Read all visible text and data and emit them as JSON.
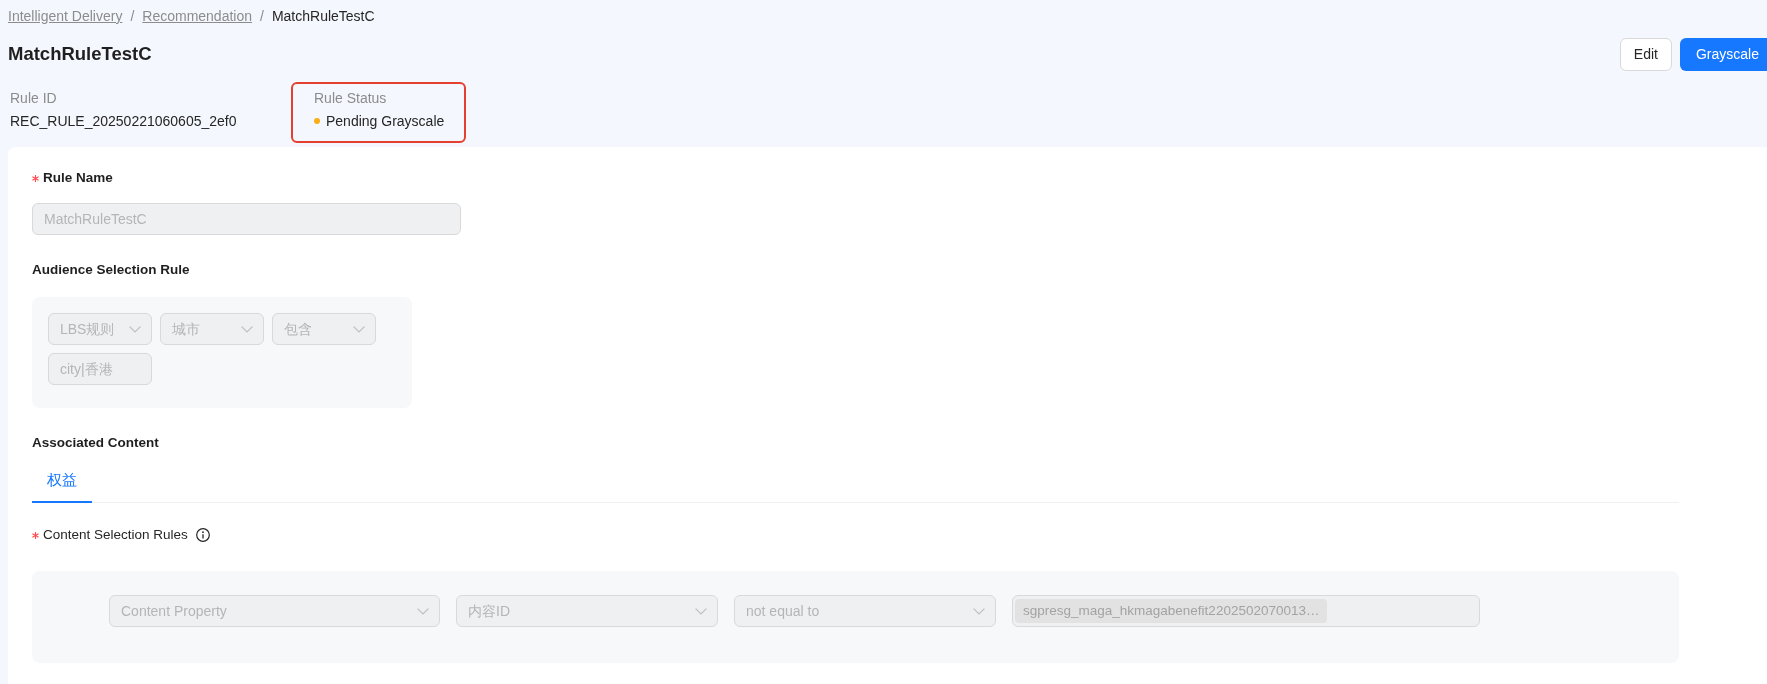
{
  "breadcrumb": [
    {
      "kind": "link",
      "label": "Intelligent Delivery"
    },
    {
      "kind": "separator",
      "label": "/"
    },
    {
      "kind": "link",
      "label": "Recommendation"
    },
    {
      "kind": "separator",
      "label": "/"
    },
    {
      "kind": "current",
      "label": "MatchRuleTestC"
    }
  ],
  "header": {
    "title": "MatchRuleTestC",
    "actions": [
      {
        "kind": "default",
        "label": "Edit"
      },
      {
        "kind": "primary",
        "label": "Grayscale"
      }
    ]
  },
  "details": [
    {
      "kind": "text",
      "label": "Rule ID",
      "value": "REC_RULE_20250221060605_2ef0",
      "highlighted": false
    },
    {
      "kind": "status",
      "label": "Rule Status",
      "value": "Pending Grayscale",
      "color": "#faad14",
      "highlighted": true
    }
  ],
  "form": {
    "rule_name": {
      "label": "Rule Name",
      "required": true,
      "field": {
        "kind": "input",
        "value": "MatchRuleTestC",
        "disabled": true
      }
    },
    "audience_selection_rule": {
      "label": "Audience Selection Rule",
      "fields": [
        {
          "kind": "select",
          "value": "LBS规则",
          "disabled": true
        },
        {
          "kind": "select",
          "value": "城市",
          "disabled": true
        },
        {
          "kind": "select",
          "value": "包含",
          "disabled": true
        },
        {
          "kind": "input",
          "value": "city|香港",
          "disabled": true
        }
      ]
    },
    "associated_content": {
      "label": "Associated Content",
      "tabs": [
        {
          "label": "权益",
          "selected": true
        }
      ],
      "content_selection_rules": {
        "label": "Content Selection Rules",
        "required": true,
        "fields": [
          {
            "kind": "select",
            "value": "Content Property",
            "disabled": true
          },
          {
            "kind": "select",
            "value": "内容ID",
            "disabled": true
          },
          {
            "kind": "select",
            "value": "not equal to",
            "disabled": true
          },
          {
            "kind": "tags",
            "tags": [
              "sgpresg_maga_hkmagabenefit2202502070013…"
            ],
            "disabled": true
          }
        ]
      }
    }
  }
}
